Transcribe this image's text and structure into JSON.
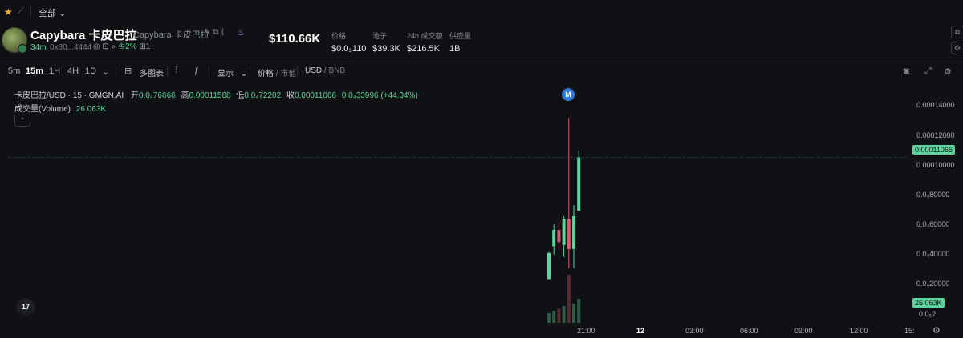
{
  "topbar": {
    "star_icon": "star-icon",
    "chart_icon": "chart-line-icon",
    "scope": "全部",
    "scope_icon": "chevron-down-icon"
  },
  "token": {
    "name": "Capybara 卡皮巴拉",
    "alias": "Capybara 卡皮巴拉",
    "age": "34m",
    "address": "0x80...4444",
    "holder_pct": "2%",
    "count": "1",
    "price": "$110.66K",
    "stats": [
      {
        "label": "价格",
        "value": "$0.0₃110"
      },
      {
        "label": "池子",
        "value": "$39.3K"
      },
      {
        "label": "24h 成交额",
        "value": "$216.5K"
      },
      {
        "label": "供应量",
        "value": "1B"
      }
    ]
  },
  "toolbar": {
    "timeframes": [
      "5m",
      "15m",
      "1H",
      "4H",
      "1D"
    ],
    "active_timeframe": "15m",
    "multi_chart": "多图表",
    "display": "显示",
    "price_label": "价格",
    "mcap_label": "市值",
    "usd_label": "USD",
    "bnb_label": "BNB"
  },
  "legend": {
    "symbol": "卡皮巴拉/USD · 15 · GMGN.AI",
    "open_label": "开",
    "open": "0.0₄76666",
    "high_label": "高",
    "high": "0.00011588",
    "low_label": "低",
    "low": "0.0₄72202",
    "close_label": "收",
    "close": "0.00011066",
    "change": "0.0₄33996 (+44.34%)",
    "volume_label": "成交量(Volume)",
    "volume": "26.063K"
  },
  "marker": "M",
  "y_axis": [
    "0.00014000",
    "0.00012000",
    "0.00010000",
    "0.0₄80000",
    "0.0₄60000",
    "0.0₄40000",
    "0.0₄20000",
    "0.0₅2"
  ],
  "x_axis": [
    "21:00",
    "12",
    "03:00",
    "06:00",
    "09:00",
    "12:00",
    "15:"
  ],
  "last_price_tag": "0.00011066",
  "volume_tag": "26.063K",
  "logo_text": "17",
  "colors": {
    "up": "#5dd39e",
    "down": "#e0566f",
    "accent": "#2f7ad8"
  },
  "chart_data": {
    "type": "candlestick",
    "candles": [
      {
        "open": 2.2e-05,
        "high": 4.2e-05,
        "low": 2.2e-05,
        "close": 4.1e-05
      },
      {
        "open": 4.6e-05,
        "high": 6.2e-05,
        "low": 4e-05,
        "close": 5.8e-05
      },
      {
        "open": 5.8e-05,
        "high": 6.5e-05,
        "low": 4.4e-05,
        "close": 4.9e-05
      },
      {
        "open": 4.7e-05,
        "high": 6.8e-05,
        "low": 3.8e-05,
        "close": 6.6e-05
      },
      {
        "open": 6.6e-05,
        "high": 0.00014,
        "low": 3e-05,
        "close": 4.4e-05
      },
      {
        "open": 4.4e-05,
        "high": 7.6e-05,
        "low": 3e-05,
        "close": 6.8e-05
      },
      {
        "open": 7.2e-05,
        "high": 0.000116,
        "low": 7.2e-05,
        "close": 0.000111
      }
    ],
    "volumes": [
      4,
      5,
      6,
      7,
      20,
      8,
      10
    ],
    "ylim": [
      0,
      0.00015
    ]
  }
}
